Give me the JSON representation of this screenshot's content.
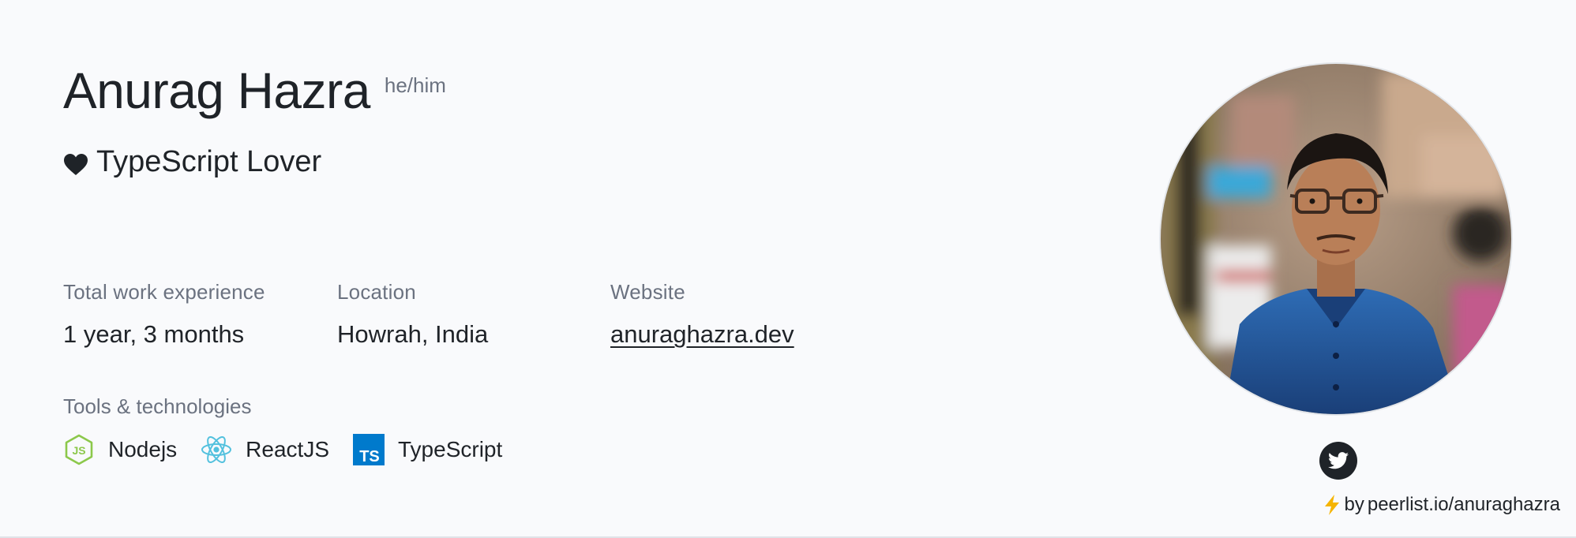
{
  "profile": {
    "name": "Anurag Hazra",
    "pronouns": "he/him",
    "headline": "TypeScript Lover"
  },
  "info": {
    "experience": {
      "label": "Total work experience",
      "value": "1 year, 3 months"
    },
    "location": {
      "label": "Location",
      "value": "Howrah, India"
    },
    "website": {
      "label": "Website",
      "value": "anuraghazra.dev"
    }
  },
  "tools": {
    "label": "Tools & technologies",
    "items": [
      {
        "name": "Nodejs",
        "icon": "nodejs-icon",
        "color": "#8cc84b"
      },
      {
        "name": "ReactJS",
        "icon": "react-icon",
        "color": "#53c1de"
      },
      {
        "name": "TypeScript",
        "icon": "typescript-icon",
        "color": "#007acc"
      }
    ]
  },
  "social": {
    "twitter_icon": "twitter-icon"
  },
  "footer": {
    "credit_by": "by",
    "credit_link": "peerlist.io/anuraghazra"
  },
  "colors": {
    "text": "#1f2328",
    "muted": "#6b7280",
    "background": "#f9fafc",
    "heart": "#1f2328",
    "bolt": "#f5b400"
  }
}
